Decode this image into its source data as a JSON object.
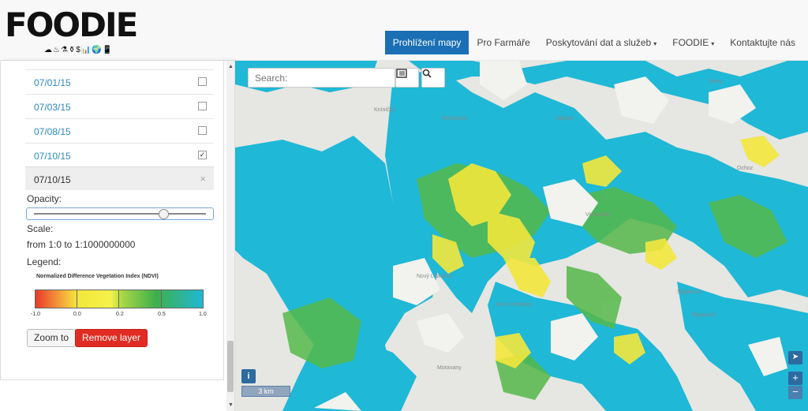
{
  "header": {
    "logo_text": "FOODIE",
    "logo_icons": "☁♨⚗⚱$📊🌍📱",
    "nav": [
      {
        "label": "Prohlížení mapy",
        "active": true,
        "caret": false
      },
      {
        "label": "Pro Farmáře",
        "active": false,
        "caret": false
      },
      {
        "label": "Poskytování dat a služeb",
        "active": false,
        "caret": true
      },
      {
        "label": "FOODIE",
        "active": false,
        "caret": true
      },
      {
        "label": "Kontaktujte nás",
        "active": false,
        "caret": false
      }
    ],
    "caret_glyph": "▾"
  },
  "panel": {
    "dates": [
      {
        "label": "07/01/15",
        "checked": false
      },
      {
        "label": "07/03/15",
        "checked": false
      },
      {
        "label": "07/08/15",
        "checked": false
      },
      {
        "label": "07/10/15",
        "checked": true
      }
    ],
    "check_glyph": "✓",
    "selected_layer": "07/10/15",
    "close_glyph": "×",
    "opacity_label": "Opacity:",
    "opacity_value": 0.75,
    "scale_label": "Scale:",
    "scale_value": "from 1:0 to 1:1000000000",
    "legend_label": "Legend:",
    "legend": {
      "title": "Normalized Difference Vegetation Index (NDVI)",
      "ticks": [
        "-1.0",
        "0.0",
        "0.2",
        "0.5",
        "1.0"
      ]
    },
    "zoom_button": "Zoom to",
    "remove_button": "Remove layer"
  },
  "map": {
    "search_placeholder": "Search:",
    "layers_icon": "layers-icon",
    "search_icon": "search-icon",
    "info_label": "i",
    "scale_text": "3 km",
    "locate_glyph": "➤",
    "zoom_in": "+",
    "zoom_out": "−",
    "colors": {
      "ndvi_high": "#1fb8d6",
      "ndvi_mid": "#55b84a",
      "ndvi_low": "#f3e73c",
      "base": "#e6e6e2"
    }
  }
}
